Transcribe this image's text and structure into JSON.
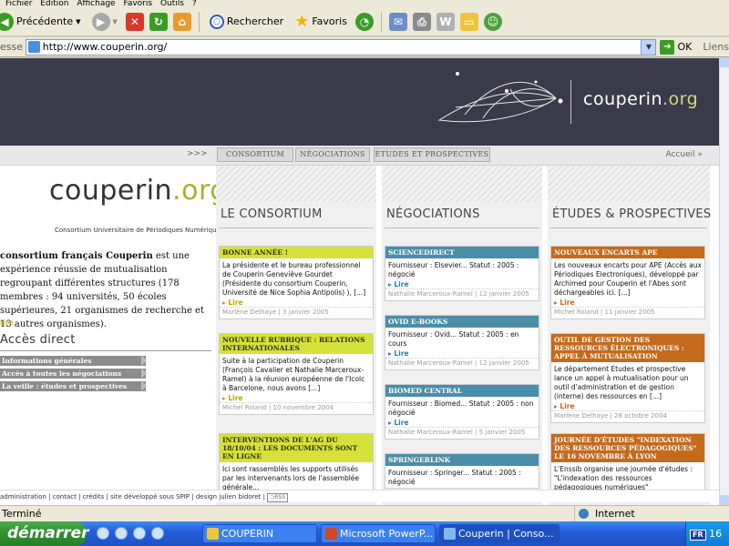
{
  "browser": {
    "menu": [
      "Fichier",
      "Édition",
      "Affichage",
      "Favoris",
      "Outils",
      "?"
    ],
    "toolbar": {
      "back": "Précédente",
      "search": "Rechercher",
      "favorites": "Favoris"
    },
    "address_label": "Adresse",
    "address": "http://www.couperin.org/",
    "go": "OK",
    "links": "Liens",
    "status": "Terminé",
    "zone": "Internet"
  },
  "taskbar": {
    "start": "démarrer",
    "tasks": [
      {
        "label": "COUPERIN"
      },
      {
        "label": "Microsoft PowerP..."
      },
      {
        "label": "Couperin | Conso..."
      }
    ],
    "tray_lang": "FR",
    "clock": "16"
  },
  "site": {
    "banner_logo_a": "couperin",
    "banner_logo_b": ".org",
    "nav": {
      "arrows": ">>>",
      "tabs": [
        "CONSORTIUM",
        "NÉGOCIATIONS",
        "ÉTUDES ET PROSPECTIVES"
      ],
      "accueil": "Accueil »"
    },
    "logo_a": "couperin",
    "logo_b": ".org",
    "subtitle": "Consortium Universitaire de Périodiques Numériques",
    "intro_bold": "consortium français Couperin",
    "intro_rest": " est une expérience réussie de mutualisation regroupant différentes structures (178 membres : 94 universités, 50 écoles supérieures, 21 organismes de recherche et 13 autres organismes).",
    "intro_lire": "Lire",
    "acces_title": "Accès direct",
    "acces_items": [
      "Informations générales",
      "Accès à toutes les négociations",
      "La veille : études et prospectives"
    ],
    "columns": [
      {
        "title": "LE CONSORTIUM",
        "cards": [
          {
            "head": "BONNE ANNÉE !",
            "body": "La présidente et le bureau professionnel de Couperin Geneviève Gourdet (Présidente du consortium Couperin, Université de Nice Sophia Antipolis) ), [...]",
            "lire": "Lire",
            "meta": "Marlène Delhaye | 3 janvier 2005"
          },
          {
            "head": "NOUVELLE RUBRIQUE : RELATIONS INTERNATIONALES",
            "body": "Suite à la participation de Couperin (François Cavalier et Nathalie Marceroux-Ramel) à la réunion européenne de l'Icolc à Barcelone, nous avons [...]",
            "lire": "Lire",
            "meta": "Michel Roland | 10 novembre 2004"
          },
          {
            "head": "INTERVENTIONS DE L'AG DU 18/10/04 : LES DOCUMENTS SONT EN LIGNE",
            "body": "Ici sont rassemblés les supports utilisés par les intervenants lors de l'assemblée générale...",
            "lire": "",
            "meta": ""
          }
        ]
      },
      {
        "title": "NÉGOCIATIONS",
        "cards": [
          {
            "head": "SCIENCEDIRECT",
            "body": "Fournisseur : Elsevier... Statut : 2005 : négocié",
            "lire": "Lire",
            "meta": "Nathalie Marceroux-Ramel | 12 janvier 2005"
          },
          {
            "head": "OVID E-BOOKS",
            "body": "Fournisseur : Ovid... Statut : 2005 : en cours",
            "lire": "Lire",
            "meta": "Nathalie Marceroux-Ramel | 12 janvier 2005"
          },
          {
            "head": "BIOMED CENTRAL",
            "body": "Fournisseur : Biomed... Statut : 2005 : non négocié",
            "lire": "Lire",
            "meta": "Nathalie Marceroux-Ramel | 5 janvier 2005"
          },
          {
            "head": "SPRINGERLINK",
            "body": "Fournisseur : Springer... Statut : 2005 : négocié",
            "lire": "",
            "meta": ""
          }
        ]
      },
      {
        "title": "ÉTUDES & PROSPECTIVES",
        "cards": [
          {
            "head": "NOUVEAUX ENCARTS APE",
            "body": "Les nouveaux encarts pour APE (Accès aux Périodiques Electroniques), développé par Archimed pour Couperin et l'Abes sont déchargeables ici. [...]",
            "lire": "Lire",
            "meta": "Michel Roland | 11 janvier 2005"
          },
          {
            "head": "OUTIL DE GESTION DES RESSOURCES ÉLECTRONIQUES : APPEL À MUTUALISATION",
            "body": "Le département Etudes et prospective lance un appel à mutualisation pour un outil d'administration et de gestion (interne) des ressources en [...]",
            "lire": "Lire",
            "meta": "Marlène Delhaye | 28 octobre 2004"
          },
          {
            "head": "JOURNÉE D'ÉTUDES \"INDEXATION DES RESSOURCES PÉDAGOGIQUES\" LE 16 NOVEMBRE À LYON",
            "body": "L'Enssib organise une journée d'études : \"L'indexation des ressources pédagogiques numériques\"",
            "lire": "",
            "meta": ""
          }
        ]
      }
    ],
    "footer": "administration | contact | crédits | site développé sous SPIP | design julien bidoret |",
    "rss": "RSS"
  },
  "colors": {
    "banner": "#3b3a4a",
    "accent_green": "#a9b02c",
    "card_yellow": "#d6e13a",
    "card_blue": "#4a8ea8",
    "card_orange": "#c46a1c"
  }
}
